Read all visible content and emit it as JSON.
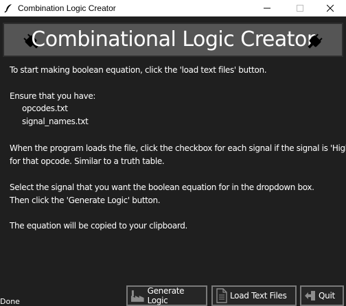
{
  "window": {
    "title": "Combination Logic Creator",
    "app_icon": "feather-icon"
  },
  "header": {
    "title": "Combinational Logic Creator",
    "left_icon": "plug-icon",
    "right_icon": "plug-icon"
  },
  "instructions": {
    "line1": "To start making boolean equation, click the 'load text files' button.",
    "line2": "Ensure that you have:",
    "file1": "opcodes.txt",
    "file2": "signal_names.txt",
    "line3": "When the program loads the file, click the checkbox for each signal if the signal is 'High'",
    "line4": "for that opcode. Similar to a truth table.",
    "line5": "Select the signal that you want the boolean equation for in the dropdown box.",
    "line6": "Then click the 'Generate Logic' button.",
    "line7": "The equation will be copied to your clipboard."
  },
  "buttons": {
    "generate": {
      "label": "Generate Logic",
      "icon": "factory-icon"
    },
    "load": {
      "label": "Load Text Files",
      "icon": "document-icon"
    },
    "quit": {
      "label": "Quit",
      "icon": "exit-arrow-icon"
    }
  },
  "status": {
    "text": "Done"
  },
  "colors": {
    "background": "#1f1f1f",
    "banner": "#555555",
    "text": "#ffffff",
    "button_border": "#7a7a7a"
  }
}
